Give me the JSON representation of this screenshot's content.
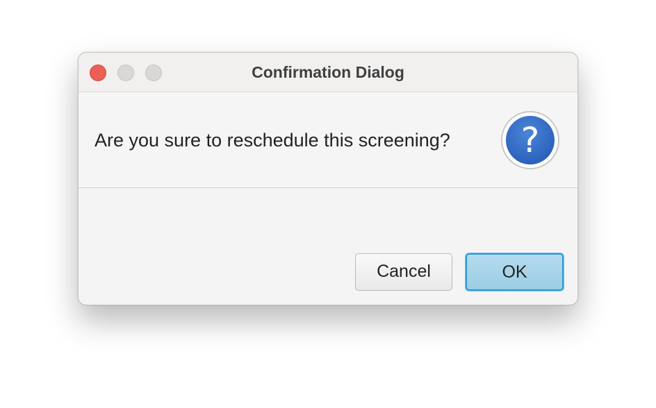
{
  "window": {
    "title": "Confirmation Dialog"
  },
  "dialog": {
    "message": "Are you sure to reschedule this screening?",
    "icon": "question-mark-icon",
    "icon_glyph": "?"
  },
  "buttons": {
    "cancel_label": "Cancel",
    "ok_label": "OK"
  },
  "colors": {
    "close_button": "#ec5f57",
    "inactive_traffic": "#d9d8d7",
    "question_icon": "#2d63bd",
    "default_button_border": "#2a9bd6",
    "default_button_fill": "#a8d4e9"
  }
}
